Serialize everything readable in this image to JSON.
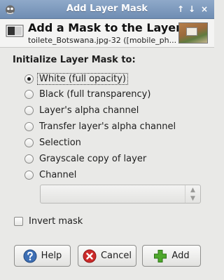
{
  "window": {
    "title": "Add Layer Mask",
    "buttons": [
      "↑",
      "↓",
      "×"
    ]
  },
  "header": {
    "title": "Add a Mask to the Layer",
    "subtitle": "toilete_Botswana.jpg-32 ([mobile_ph..."
  },
  "section_label": "Initialize Layer Mask to:",
  "options": [
    {
      "label": "White (full opacity)",
      "selected": true
    },
    {
      "label": "Black (full transparency)",
      "selected": false
    },
    {
      "label": "Layer's alpha channel",
      "selected": false
    },
    {
      "label": "Transfer layer's alpha channel",
      "selected": false
    },
    {
      "label": "Selection",
      "selected": false
    },
    {
      "label": "Grayscale copy of layer",
      "selected": false
    },
    {
      "label": "Channel",
      "selected": false
    }
  ],
  "channel_select": {
    "value": ""
  },
  "invert_mask": {
    "label": "Invert mask",
    "checked": false
  },
  "buttons": {
    "help": "Help",
    "cancel": "Cancel",
    "add": "Add"
  },
  "colors": {
    "titlebar": "#7a97bd",
    "help_icon": "#3d6fb5",
    "cancel_icon": "#cc2a2a",
    "add_icon": "#4ea82c"
  }
}
